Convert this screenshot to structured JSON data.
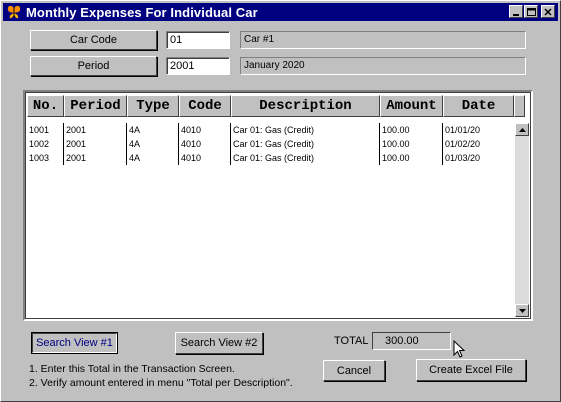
{
  "window": {
    "title": "Monthly Expenses For Individual Car",
    "controls": {
      "minimize_icon": "minimize-icon",
      "maximize_icon": "maximize-icon",
      "close_icon": "close-icon"
    }
  },
  "form": {
    "car_code": {
      "button_label": "Car Code",
      "value": "01",
      "description": "Car #1"
    },
    "period": {
      "button_label": "Period",
      "value": "2001",
      "description": "January 2020"
    }
  },
  "table": {
    "columns": [
      "No.",
      "Period",
      "Type",
      "Code",
      "Description",
      "Amount",
      "Date"
    ],
    "rows": [
      [
        "1001",
        "2001",
        "4A",
        "4010",
        "Car 01: Gas  (Credit)",
        "100.00",
        "01/01/20"
      ],
      [
        "1002",
        "2001",
        "4A",
        "4010",
        "Car 01: Gas  (Credit)",
        "100.00",
        "01/02/20"
      ],
      [
        "1003",
        "2001",
        "4A",
        "4010",
        "Car 01: Gas  (Credit)",
        "100.00",
        "01/03/20"
      ]
    ]
  },
  "footer": {
    "search_view_1": "Search View #1",
    "search_view_2": "Search View #2",
    "total_label": "TOTAL",
    "total_value": "300.00",
    "cancel": "Cancel",
    "create_excel": "Create Excel File",
    "instructions": [
      "1.  Enter this Total in the Transaction Screen.",
      "2.  Verify amount entered in  menu \"Total per Description\"."
    ]
  }
}
